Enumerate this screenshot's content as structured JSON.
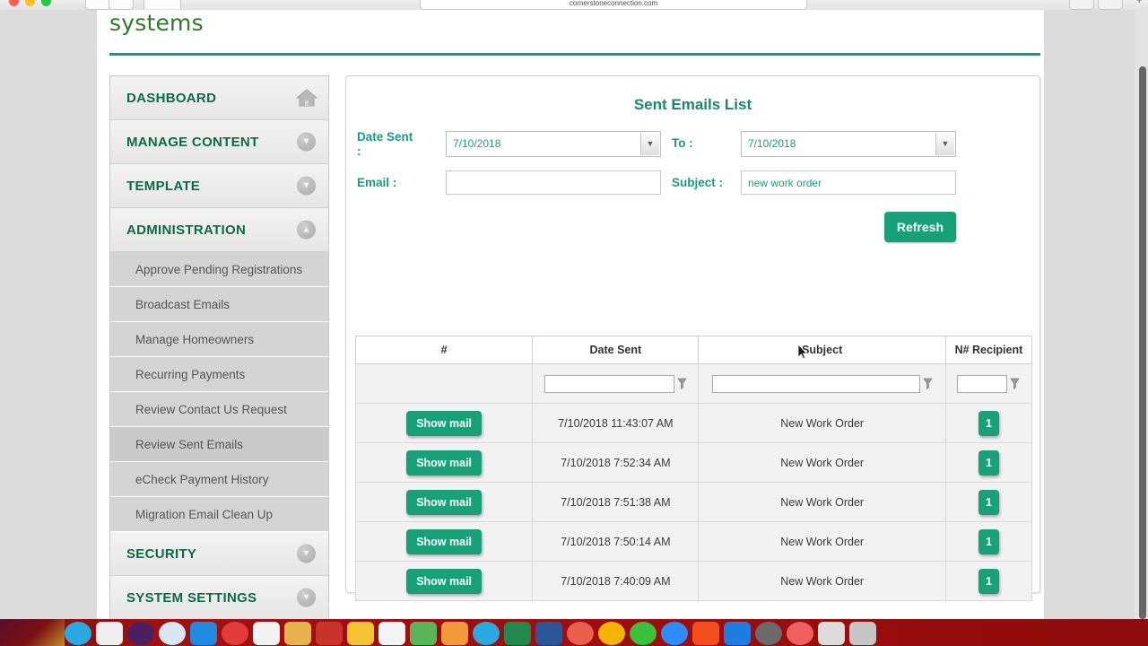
{
  "browser": {
    "url": "cornerstoneconnection.com",
    "new_tab_label": "+",
    "back_icon": "back-arrow-icon",
    "forward_icon": "forward-arrow-icon"
  },
  "brand": {
    "name": "systems"
  },
  "sidebar": {
    "top_items": [
      {
        "label": "DASHBOARD",
        "icon": "home-icon",
        "state": "link"
      },
      {
        "label": "MANAGE CONTENT",
        "icon": "chevron-down-icon",
        "state": "collapsed"
      },
      {
        "label": "TEMPLATE",
        "icon": "chevron-down-icon",
        "state": "collapsed"
      },
      {
        "label": "ADMINISTRATION",
        "icon": "chevron-up-icon",
        "state": "expanded"
      }
    ],
    "admin_children": [
      {
        "label": "Approve Pending Registrations",
        "selected": false
      },
      {
        "label": "Broadcast Emails",
        "selected": false
      },
      {
        "label": "Manage Homeowners",
        "selected": false
      },
      {
        "label": "Recurring Payments",
        "selected": false
      },
      {
        "label": "Review Contact Us Request",
        "selected": false
      },
      {
        "label": "Review Sent Emails",
        "selected": true
      },
      {
        "label": "eCheck Payment History",
        "selected": false
      },
      {
        "label": "Migration Email Clean Up",
        "selected": false
      }
    ],
    "bottom_items": [
      {
        "label": "SECURITY",
        "icon": "chevron-down-icon",
        "state": "collapsed"
      },
      {
        "label": "SYSTEM SETTINGS",
        "icon": "chevron-down-icon",
        "state": "collapsed"
      }
    ]
  },
  "card": {
    "title": "Sent Emails List"
  },
  "filters": {
    "date_sent_label": "Date Sent :",
    "date_sent_value": "7/10/2018",
    "to_label": "To :",
    "to_value": "7/10/2018",
    "email_label": "Email :",
    "email_value": "",
    "email_placeholder": "",
    "subject_label": "Subject :",
    "subject_value": "new work order",
    "subject_placeholder": "",
    "refresh_label": "Refresh"
  },
  "grid": {
    "columns": [
      "#",
      "Date Sent",
      "Subject",
      "N# Recipient"
    ],
    "column_filters": {
      "date_sent": "",
      "subject": "",
      "recipient": ""
    },
    "rows": [
      {
        "action": "Show mail",
        "date_sent": "7/10/2018 11:43:07 AM",
        "subject": "New Work Order",
        "recipients": "1"
      },
      {
        "action": "Show mail",
        "date_sent": "7/10/2018 7:52:34 AM",
        "subject": "New Work Order",
        "recipients": "1"
      },
      {
        "action": "Show mail",
        "date_sent": "7/10/2018 7:51:38 AM",
        "subject": "New Work Order",
        "recipients": "1"
      },
      {
        "action": "Show mail",
        "date_sent": "7/10/2018 7:50:14 AM",
        "subject": "New Work Order",
        "recipients": "1"
      },
      {
        "action": "Show mail",
        "date_sent": "7/10/2018 7:40:09 AM",
        "subject": "New Work Order",
        "recipients": "1"
      }
    ]
  },
  "colors": {
    "accent_green": "#16a179",
    "brand_green": "#2d7a2d",
    "heading_green": "#168a68",
    "nav_label_green": "#0c6b43",
    "page_background": "#dcdcdc",
    "dock_background": "#9d0d0d"
  },
  "dock": {
    "icons": [
      {
        "name": "finder-icon",
        "color": "#2aa9e0"
      },
      {
        "name": "launchpad-icon",
        "color": "#efefef"
      },
      {
        "name": "siri-icon",
        "color": "#4a2060"
      },
      {
        "name": "safari-icon",
        "color": "#d8e8f2"
      },
      {
        "name": "appstore-icon",
        "color": "#1e8ae0"
      },
      {
        "name": "mail-icon",
        "color": "#e23b3b"
      },
      {
        "name": "news-icon",
        "color": "#f2f2f2"
      },
      {
        "name": "notes-icon",
        "color": "#e8b34a"
      },
      {
        "name": "books-icon",
        "color": "#c9342a"
      },
      {
        "name": "reminders-icon",
        "color": "#f4c430"
      },
      {
        "name": "pages-icon",
        "color": "#f4f4f4"
      },
      {
        "name": "numbers-icon",
        "color": "#5ab55a"
      },
      {
        "name": "photos-icon",
        "color": "#f29a3a"
      },
      {
        "name": "skype-icon",
        "color": "#29abe2"
      },
      {
        "name": "excel-icon",
        "color": "#1f8a4c"
      },
      {
        "name": "word-icon",
        "color": "#2b579a"
      },
      {
        "name": "firefox-icon",
        "color": "#e8604c"
      },
      {
        "name": "chrome-icon",
        "color": "#f5b400"
      },
      {
        "name": "messages-icon",
        "color": "#3cc13b"
      },
      {
        "name": "zoom-icon",
        "color": "#2d8cff"
      },
      {
        "name": "outlook-icon",
        "color": "#f24e1e"
      },
      {
        "name": "onedrive-icon",
        "color": "#1e7de0"
      },
      {
        "name": "settings-icon",
        "color": "#6a6a6a"
      },
      {
        "name": "adobe-icon",
        "color": "#f06060"
      },
      {
        "name": "downloads-stack-icon",
        "color": "#dcdcdc"
      },
      {
        "name": "trash-icon",
        "color": "#c6c6c6"
      }
    ]
  }
}
